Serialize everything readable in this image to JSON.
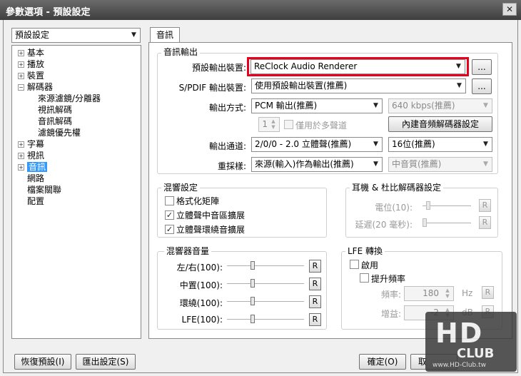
{
  "window": {
    "title": "參數選項 - 預設設定",
    "close": "✕"
  },
  "sidebar": {
    "profile": "預設設定",
    "tree": [
      {
        "label": "基本",
        "exp": "+"
      },
      {
        "label": "播放",
        "exp": "+"
      },
      {
        "label": "裝置",
        "exp": "+"
      },
      {
        "label": "解碼器",
        "exp": "−"
      },
      {
        "label": "來源濾鏡/分離器"
      },
      {
        "label": "視訊解碼"
      },
      {
        "label": "音訊解碼"
      },
      {
        "label": "濾鏡優先權"
      },
      {
        "label": "字幕",
        "exp": "+"
      },
      {
        "label": "視訊",
        "exp": "+"
      },
      {
        "label": "音訊",
        "exp": "+"
      },
      {
        "label": "網路"
      },
      {
        "label": "檔案關聯"
      },
      {
        "label": "配置"
      }
    ]
  },
  "tab": {
    "label": "音訊"
  },
  "audio_output": {
    "group": "音訊輸出",
    "device_label": "預設輸出裝置:",
    "device_value": "ReClock Audio Renderer",
    "spdif_label": "S/PDIF 輸出裝置:",
    "spdif_value": "使用預設輸出裝置(推薦)",
    "browse": "...",
    "mode_label": "輸出方式:",
    "mode_value": "PCM 輸出(推薦)",
    "bitrate_value": "640 kbps(推薦)",
    "count_value": "1",
    "multichannel_label": "僅用於多聲道",
    "internal_decoder_btn": "內建音頻解碼器設定",
    "channel_label": "輸出通道:",
    "channel_value": "2/0/0 - 2.0 立體聲(推薦)",
    "bits_value": "16位(推薦)",
    "resample_label": "重採樣:",
    "resample_value": "來源(輸入)作為輸出(推薦)",
    "quality_value": "中音質(推薦)"
  },
  "mixer": {
    "group": "混響設定",
    "items": [
      {
        "label": "格式化矩陣",
        "checked": false
      },
      {
        "label": "立體聲中音區擴展",
        "checked": true
      },
      {
        "label": "立體聲環繞音擴展",
        "checked": true
      }
    ]
  },
  "headphone": {
    "group": "耳機 & 杜比解碼器設定",
    "level_label": "電位(10):",
    "delay_label": "延遲(20 毫秒):"
  },
  "mixer_volume": {
    "group": "混響器音量",
    "rows": [
      {
        "label": "左/右(100):"
      },
      {
        "label": "中置(100):"
      },
      {
        "label": "環繞(100):"
      },
      {
        "label": "LFE(100):"
      }
    ]
  },
  "lfe": {
    "group": "LFE 轉換",
    "enable_label": "啟用",
    "boost_label": "提升頻率",
    "freq_label": "頻率:",
    "freq_value": "180",
    "freq_unit": "Hz",
    "gain_label": "增益:",
    "gain_value": "-2",
    "gain_unit": "dB"
  },
  "reset_label": "R",
  "footer": {
    "restore": "恢復預設(I)",
    "export": "匯出設定(S)",
    "ok": "確定(O)",
    "cancel": "取"
  },
  "watermark": {
    "logo": "HD",
    "sub": "CLUB",
    "url": "www.HD-Club.tw"
  },
  "colors": {
    "highlight": "#e8001c",
    "title_bar": "#4a4a4a"
  }
}
